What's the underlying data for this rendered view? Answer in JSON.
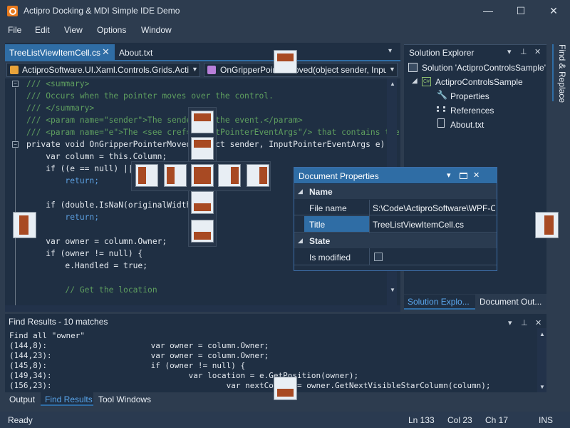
{
  "window": {
    "title": "Actipro Docking & MDI Simple IDE Demo",
    "minimize": "—",
    "maximize": "☐",
    "close": "✕"
  },
  "menu": [
    "File",
    "Edit",
    "View",
    "Options",
    "Window"
  ],
  "tabs": {
    "active": "TreeListViewItemCell.cs",
    "active_close": "✕",
    "second": "About.txt",
    "overflow": "▾"
  },
  "navbar": {
    "type_combo": "ActiproSoftware.UI.Xaml.Controls.Grids.Actip",
    "member_combo": "OnGripperPointerMoved(object sender, Inpu"
  },
  "code_lines": [
    "/// <summary>",
    "/// Occurs when the pointer moves over the control.",
    "/// </summary>",
    "/// <param name=\"sender\">The sender of the event.</param>",
    "/// <param name=\"e\">The <see cref=\"InputPointerEventArgs\"/> that contains the",
    "private void OnGripperPointerMoved(object sender, InputPointerEventArgs e) {",
    "    var column = this.Column;",
    "    if ((e == null) || (column == null))",
    "        return;",
    "",
    "    if (double.IsNaN(originalWidth))",
    "        return;",
    "",
    "    var owner = column.Owner;",
    "    if (owner != null) {",
    "        e.Handled = true;",
    "",
    "        // Get the location"
  ],
  "solution_explorer": {
    "title": "Solution Explorer",
    "items": [
      {
        "label": "Solution 'ActiproControlsSample'",
        "icon": "solution-icon"
      },
      {
        "label": "ActiproControlsSample",
        "icon": "csharp-project-icon"
      },
      {
        "label": "Properties",
        "icon": "wrench-icon"
      },
      {
        "label": "References",
        "icon": "references-icon"
      },
      {
        "label": "About.txt",
        "icon": "document-icon"
      }
    ],
    "tab1": "Solution Explo...",
    "tab2": "Document Out..."
  },
  "right_sidebar": {
    "label": "Find & Replace"
  },
  "document_properties": {
    "title": "Document Properties",
    "categories": [
      {
        "name": "Name",
        "rows": [
          {
            "key": "File name",
            "value": "S:\\Code\\ActiproSoftware\\WPF-Co"
          },
          {
            "key": "Title",
            "value": "TreeListViewItemCell.cs"
          }
        ]
      },
      {
        "name": "State",
        "rows": [
          {
            "key": "Is modified",
            "value": ""
          }
        ]
      }
    ]
  },
  "find_results": {
    "title": "Find Results - 10 matches",
    "lines": [
      "Find all \"owner\"",
      "(144,8):                      var owner = column.Owner;",
      "(144,23):                     var owner = column.Owner;",
      "(145,8):                      if (owner != null) {",
      "(149,34):                             var location = e.GetPosition(owner);",
      "(156,23):                                     var nextColumn = owner.GetNextVisibleStarColumn(column);"
    ]
  },
  "bottom_tabs": [
    "Output",
    "Find Results",
    "Tool Windows"
  ],
  "status": {
    "text": "Ready",
    "line": "Ln 133",
    "col": "Col 23",
    "ch": "Ch 17",
    "mode": "INS"
  },
  "colors": {
    "accent": "#2f6da5",
    "background": "#2d3c4f",
    "panel": "#1f2f43",
    "dock_guide": "#a84a23"
  }
}
